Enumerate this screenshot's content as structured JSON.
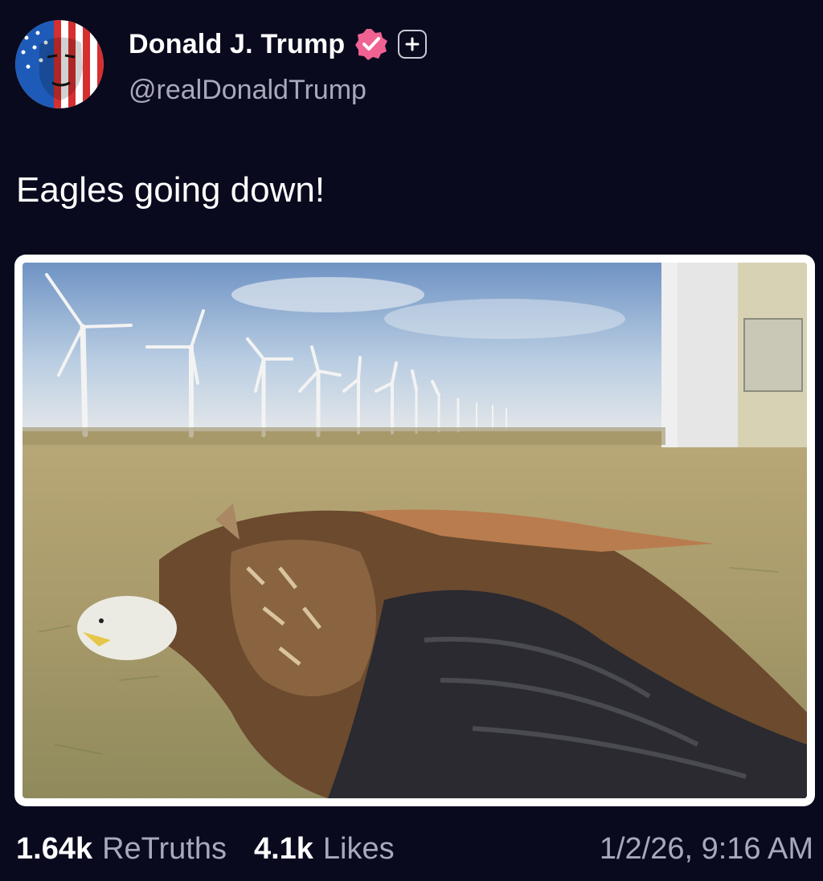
{
  "author": {
    "display_name": "Donald J. Trump",
    "handle": "@realDonaldTrump",
    "avatar_icon": "flag-portrait-avatar",
    "verified_icon": "verified-badge-icon",
    "verified_color": "#f06292",
    "follow_icon": "plus-icon"
  },
  "post": {
    "text": "Eagles going down!",
    "image_icon": "dead-eagle-wind-turbines-photo"
  },
  "stats": {
    "retruths_count": "1.64k",
    "retruths_label": "ReTruths",
    "likes_count": "4.1k",
    "likes_label": "Likes",
    "timestamp": "1/2/26, 9:16 AM"
  },
  "colors": {
    "background": "#0a0a1f",
    "text_primary": "#ffffff",
    "text_secondary": "#a9a9bb"
  }
}
